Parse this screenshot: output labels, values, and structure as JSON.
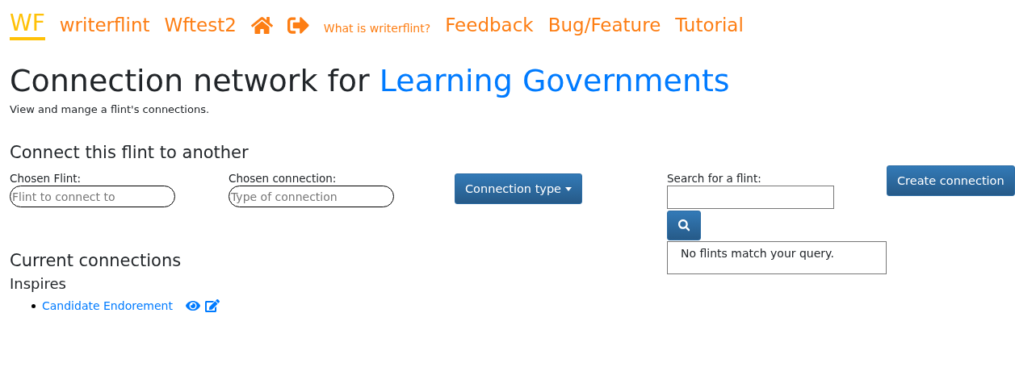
{
  "nav": {
    "logo": "WF",
    "items": [
      {
        "kind": "large-link",
        "label": "writerflint"
      },
      {
        "kind": "large-link",
        "label": "Wftest2"
      },
      {
        "kind": "home"
      },
      {
        "kind": "exit"
      },
      {
        "kind": "small-link",
        "label": "What is writerflint?"
      },
      {
        "kind": "large-link",
        "label": "Feedback"
      },
      {
        "kind": "large-link",
        "label": "Bug/Feature"
      },
      {
        "kind": "large-link",
        "label": "Tutorial"
      }
    ]
  },
  "title": "Connection network for",
  "title_link": "Learning Governments",
  "subtitle": "View and mange a flint's connections.",
  "connect": {
    "heading": "Connect this flint to another",
    "fields": [
      {
        "label": "Chosen Flint:",
        "placeholder": "Flint to connect to"
      },
      {
        "label": "Chosen connection:",
        "placeholder": "Type of connection"
      }
    ],
    "dropdown": "Connection type",
    "search": {
      "label": "Search for a flint:",
      "results": "No flints match your query."
    },
    "create_button": "Create connection"
  },
  "current": {
    "heading": "Current connections",
    "groups": [
      {
        "name": "Inspires",
        "items": [
          {
            "label": "Candidate Endorement"
          }
        ]
      }
    ]
  }
}
